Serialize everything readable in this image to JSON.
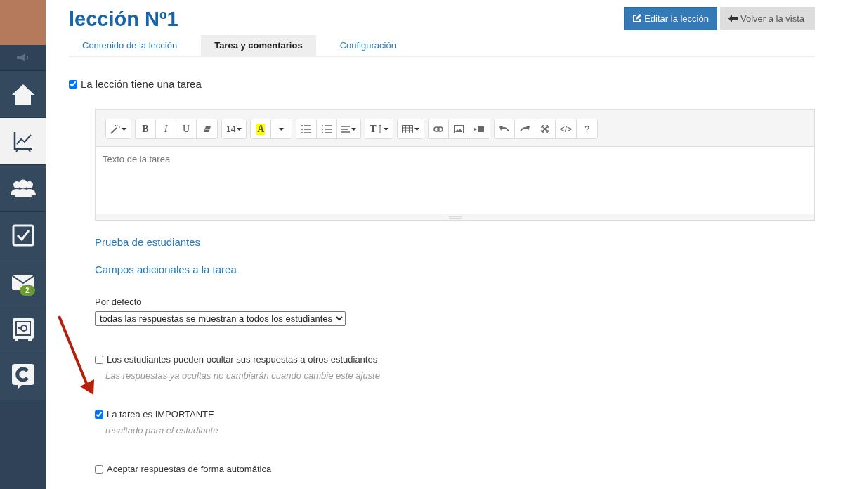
{
  "sidebar": {
    "items": [
      {
        "kind": "home",
        "selected": false
      },
      {
        "kind": "chart",
        "selected": true
      },
      {
        "kind": "users",
        "selected": false
      },
      {
        "kind": "check",
        "selected": false
      },
      {
        "kind": "mail",
        "selected": false,
        "badge": "2"
      },
      {
        "kind": "safe",
        "selected": false
      },
      {
        "kind": "chat",
        "selected": false
      }
    ]
  },
  "title": "lección Nº1",
  "actions": [
    {
      "kind": "primary",
      "label": "Editar la lección"
    },
    {
      "kind": "secondary",
      "label": "Volver a la vista"
    }
  ],
  "tabs": [
    {
      "label": "Contenido de la lección",
      "selected": false
    },
    {
      "label": "Tarea y comentarios",
      "selected": true
    },
    {
      "label": "Configuración",
      "selected": false
    }
  ],
  "has_task": {
    "label": "La lección tiene una tarea",
    "checked": true
  },
  "editor": {
    "toolbar": [
      [
        {
          "kind": "magic"
        }
      ],
      [
        {
          "kind": "bold",
          "label": "B"
        },
        {
          "kind": "italic",
          "label": "I"
        },
        {
          "kind": "underline",
          "label": "U"
        },
        {
          "kind": "eraser"
        }
      ],
      [
        {
          "kind": "size",
          "label": "14"
        }
      ],
      [
        {
          "kind": "color",
          "label": "A"
        },
        {
          "kind": "dropdown"
        }
      ],
      [
        {
          "kind": "bullets"
        },
        {
          "kind": "numbers"
        },
        {
          "kind": "align"
        }
      ],
      [
        {
          "kind": "height",
          "label": "T"
        }
      ],
      [
        {
          "kind": "table"
        }
      ],
      [
        {
          "kind": "link"
        },
        {
          "kind": "picture"
        },
        {
          "kind": "video"
        }
      ],
      [
        {
          "kind": "undo"
        },
        {
          "kind": "redo"
        },
        {
          "kind": "fullscreen"
        },
        {
          "kind": "code",
          "label": "</>"
        },
        {
          "kind": "help",
          "label": "?"
        }
      ]
    ],
    "placeholder": "Texto de la tarea"
  },
  "links": [
    "Prueba de estudiantes",
    "Campos adicionales a la tarea"
  ],
  "visibility": {
    "label": "Por defecto",
    "value": "todas las respuestas se muestran a todos los estudiantes"
  },
  "options": [
    {
      "label": "Los estudiantes pueden ocultar sus respuestas a otros estudiantes",
      "checked": false,
      "hint": "Las respuestas ya ocultas no cambiarán cuando cambie este ajuste"
    },
    {
      "label": "La tarea es IMPORTANTE",
      "checked": true,
      "hint": "resaltado para el estudiante"
    },
    {
      "label": "Aceptar respuestas de forma automática",
      "checked": false
    }
  ]
}
